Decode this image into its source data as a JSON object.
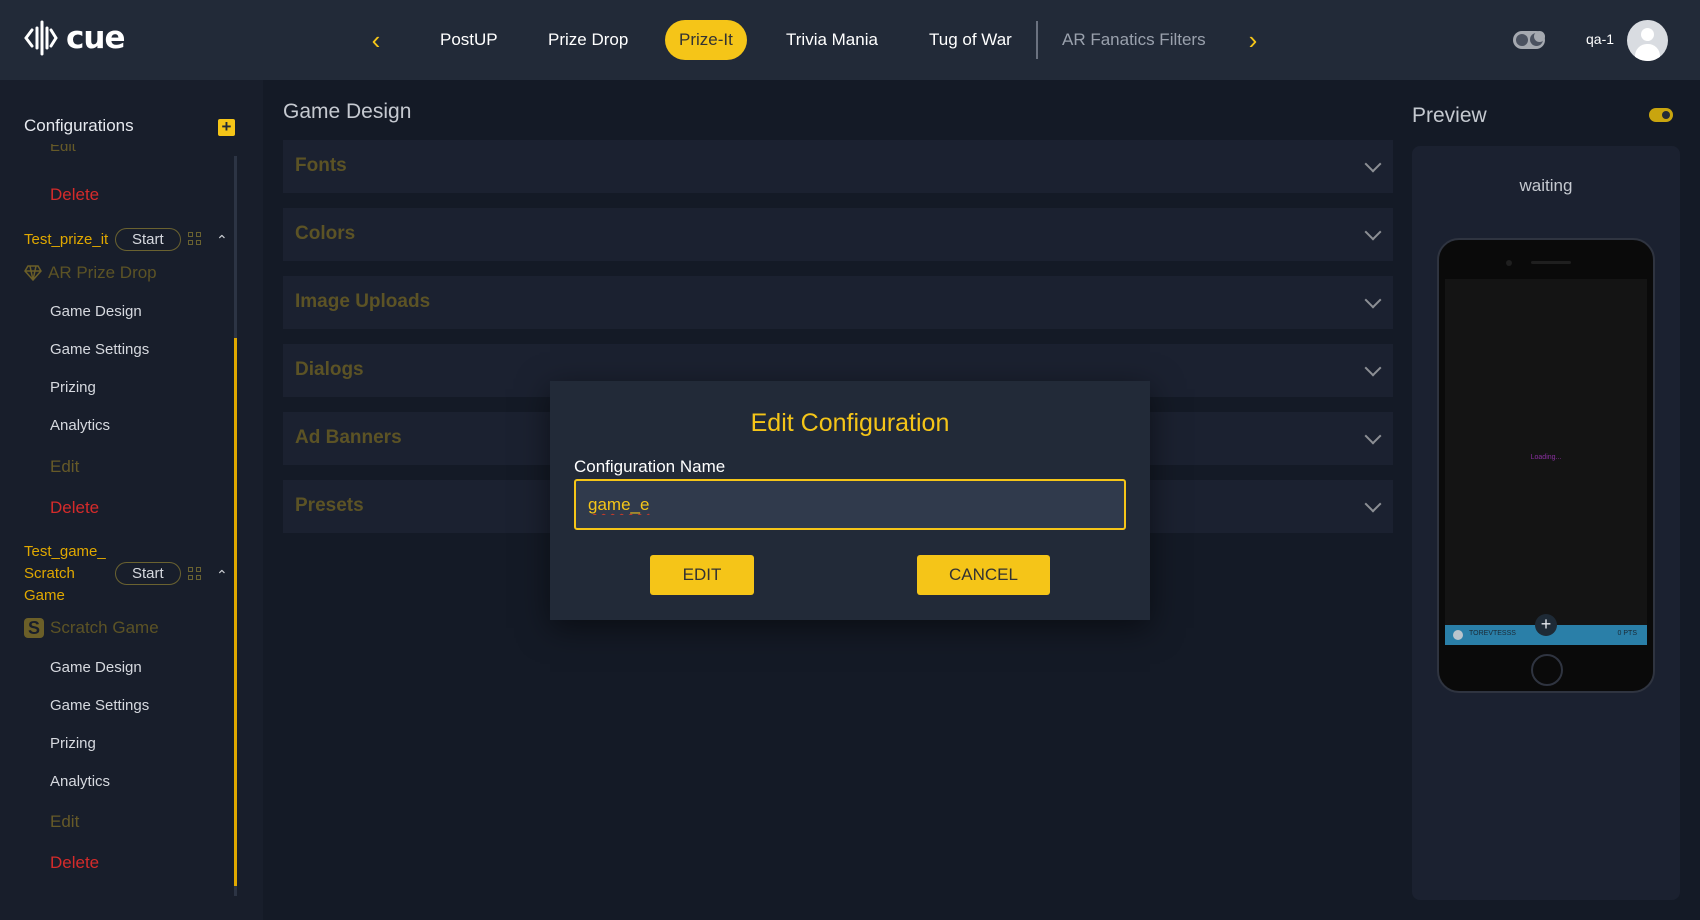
{
  "app": {
    "logo_text": "cue"
  },
  "nav": {
    "tabs": [
      {
        "label": "PostUP"
      },
      {
        "label": "Prize Drop"
      },
      {
        "label": "Prize-It"
      },
      {
        "label": "Trivia Mania"
      },
      {
        "label": "Tug of War"
      },
      {
        "label": "AR Fanatics Filters"
      }
    ],
    "active_tab": "Prize-It",
    "username": "qa-1"
  },
  "sidebar": {
    "title": "Configurations",
    "add_icon": "plus-square-icon",
    "top_edit": "Edit",
    "top_delete": "Delete",
    "configs": [
      {
        "name": "Test_prize_it",
        "start_label": "Start",
        "game_type": "AR Prize Drop",
        "items": [
          "Game Design",
          "Game Settings",
          "Prizing",
          "Analytics"
        ],
        "edit_label": "Edit",
        "delete_label": "Delete"
      },
      {
        "name_lines": [
          "Test_game_",
          "Scratch",
          "Game"
        ],
        "start_label": "Start",
        "game_type": "Scratch Game",
        "items": [
          "Game Design",
          "Game Settings",
          "Prizing",
          "Analytics"
        ],
        "edit_label": "Edit",
        "delete_label": "Delete"
      }
    ]
  },
  "main": {
    "title": "Game Design",
    "sections": [
      "Fonts",
      "Colors",
      "Image Uploads",
      "Dialogs",
      "Ad Banners",
      "Presets"
    ]
  },
  "preview": {
    "title": "Preview",
    "status": "waiting",
    "loading_text": "Loading...",
    "bar_name": "TOREVTESSS",
    "bar_points": "0 PTS"
  },
  "modal": {
    "title": "Edit Configuration",
    "field_label": "Configuration Name",
    "field_value": "game_e",
    "edit_button": "EDIT",
    "cancel_button": "CANCEL"
  },
  "colors": {
    "accent": "#f5c518",
    "topbar": "#222a38",
    "background": "#141a26",
    "danger": "#d52b2b"
  }
}
